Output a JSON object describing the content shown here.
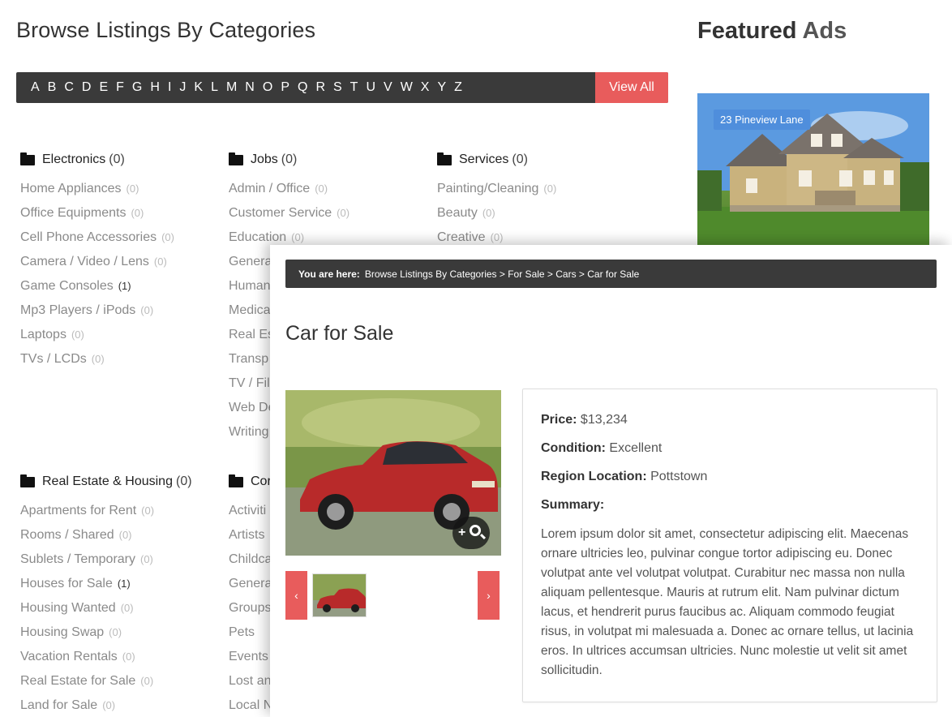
{
  "page": {
    "title": "Browse Listings By Categories",
    "featured_title_bold": "Featured",
    "featured_title_rest": "Ads"
  },
  "alphabet": {
    "letters": [
      "A",
      "B",
      "C",
      "D",
      "E",
      "F",
      "G",
      "H",
      "I",
      "J",
      "K",
      "L",
      "M",
      "N",
      "O",
      "P",
      "Q",
      "R",
      "S",
      "T",
      "U",
      "V",
      "W",
      "X",
      "Y",
      "Z"
    ],
    "view_all": "View All"
  },
  "categories": [
    {
      "name": "Electronics",
      "count": "(0)",
      "items": [
        {
          "label": "Home Appliances",
          "count": "(0)"
        },
        {
          "label": "Office Equipments",
          "count": "(0)"
        },
        {
          "label": "Cell Phone Accessories",
          "count": "(0)"
        },
        {
          "label": "Camera / Video / Lens",
          "count": "(0)"
        },
        {
          "label": "Game Consoles",
          "count": "(1)"
        },
        {
          "label": "Mp3 Players / iPods",
          "count": "(0)"
        },
        {
          "label": "Laptops",
          "count": "(0)"
        },
        {
          "label": "TVs / LCDs",
          "count": "(0)"
        }
      ]
    },
    {
      "name": "Jobs",
      "count": "(0)",
      "items": [
        {
          "label": "Admin / Office",
          "count": "(0)"
        },
        {
          "label": "Customer Service",
          "count": "(0)"
        },
        {
          "label": "Education",
          "count": "(0)"
        },
        {
          "label": "Genera",
          "count": ""
        },
        {
          "label": "Human",
          "count": ""
        },
        {
          "label": "Medica",
          "count": ""
        },
        {
          "label": "Real Es",
          "count": ""
        },
        {
          "label": "Transp",
          "count": ""
        },
        {
          "label": "TV / Fil",
          "count": ""
        },
        {
          "label": "Web De",
          "count": ""
        },
        {
          "label": "Writing",
          "count": ""
        }
      ]
    },
    {
      "name": "Services",
      "count": "(0)",
      "items": [
        {
          "label": "Painting/Cleaning",
          "count": "(0)"
        },
        {
          "label": "Beauty",
          "count": "(0)"
        },
        {
          "label": "Creative",
          "count": "(0)"
        }
      ]
    },
    {
      "name": "Real Estate & Housing",
      "count": "(0)",
      "items": [
        {
          "label": "Apartments for Rent",
          "count": "(0)"
        },
        {
          "label": "Rooms / Shared",
          "count": "(0)"
        },
        {
          "label": "Sublets / Temporary",
          "count": "(0)"
        },
        {
          "label": "Houses for Sale",
          "count": "(1)"
        },
        {
          "label": "Housing Wanted",
          "count": "(0)"
        },
        {
          "label": "Housing Swap",
          "count": "(0)"
        },
        {
          "label": "Vacation Rentals",
          "count": "(0)"
        },
        {
          "label": "Real Estate for Sale",
          "count": "(0)"
        },
        {
          "label": "Land for Sale",
          "count": "(0)"
        }
      ]
    },
    {
      "name": "Cor",
      "count": "",
      "items": [
        {
          "label": "Activiti",
          "count": ""
        },
        {
          "label": "Artists",
          "count": ""
        },
        {
          "label": "Childca",
          "count": ""
        },
        {
          "label": "Genera",
          "count": ""
        },
        {
          "label": "Groups",
          "count": ""
        },
        {
          "label": "Pets",
          "count": ""
        },
        {
          "label": "Events",
          "count": ""
        },
        {
          "label": "Lost an",
          "count": ""
        },
        {
          "label": "Local N",
          "count": ""
        }
      ]
    }
  ],
  "featured": {
    "badge": "23 Pineview Lane"
  },
  "breadcrumb": {
    "label": "You are here:",
    "path": "Browse Listings By Categories > For Sale > Cars > Car for Sale"
  },
  "ad": {
    "title": "Car for Sale",
    "price_label": "Price:",
    "price": "$13,234",
    "condition_label": "Condition:",
    "condition": "Excellent",
    "region_label": "Region Location:",
    "region": "Pottstown",
    "summary_label": "Summary:",
    "summary": "Lorem ipsum dolor sit amet, consectetur adipiscing elit. Maecenas ornare ultricies leo, pulvinar congue tortor adipiscing eu. Donec volutpat ante vel volutpat volutpat. Curabitur nec massa non nulla aliquam pellentesque. Mauris at rutrum elit. Nam pulvinar dictum lacus, et hendrerit purus faucibus ac. Aliquam commodo feugiat risus, in volutpat mi malesuada a. Donec ac ornare tellus, ut lacinia eros. In ultrices accumsan ultricies. Nunc molestie ut velit sit amet sollicitudin.",
    "prev_icon": "‹",
    "next_icon": "›"
  }
}
